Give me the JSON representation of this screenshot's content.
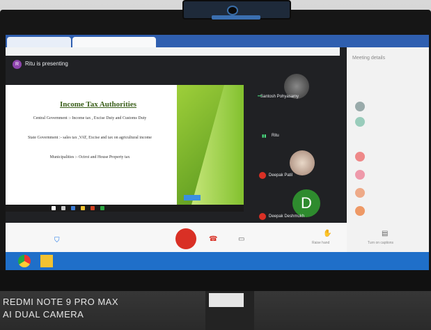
{
  "presenter_banner": "Ritu is presenting",
  "presenter_initial": "R",
  "slide": {
    "title": "Income Tax Authorities",
    "lines": [
      "Central Government :- Income tax , Excise Duty and Customs Duty",
      "State Government :- sales tax ,VAT, Excise and tax on agricultural income",
      "Municipalities :- Octroi and House Property tax"
    ]
  },
  "participants": [
    {
      "name": "Santosh Pohyasamy"
    },
    {
      "name": "Ritu"
    },
    {
      "name": "Deepak Patil"
    },
    {
      "name": "Deepak Deshmukh",
      "initial": "D"
    }
  ],
  "panel": {
    "title": "Meeting details"
  },
  "controls": {
    "raise_hand": "Raise hand",
    "captions": "Turn on captions"
  },
  "watermark": {
    "line1": "REDMI NOTE 9 PRO MAX",
    "line2": "AI DUAL CAMERA"
  },
  "colors": {
    "end_call": "#d93025",
    "presenter_avatar": "#8e44ad",
    "windows_taskbar": "#1f6fc9",
    "slide_title": "#3a5f1a",
    "deepak_avatar": "#2e8b2e"
  }
}
